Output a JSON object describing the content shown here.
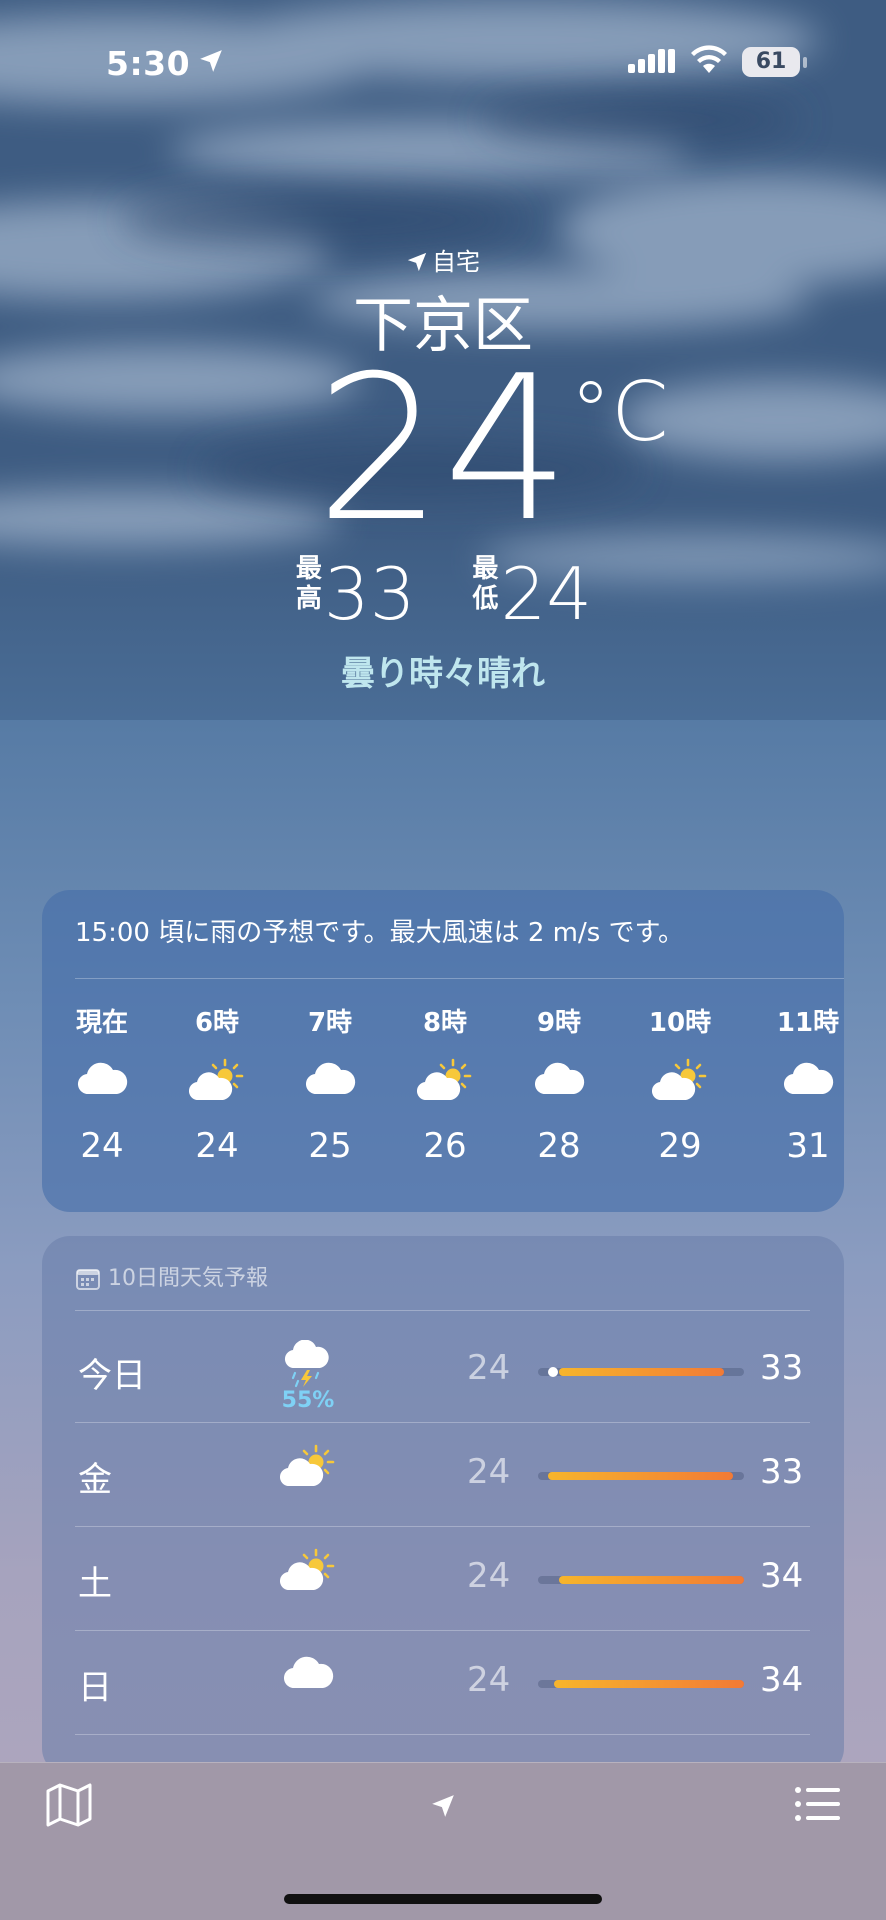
{
  "status_bar": {
    "time": "5:30",
    "battery": "61"
  },
  "location": {
    "label": "自宅",
    "city": "下京区",
    "temperature": "24",
    "unit": "°C",
    "high_label": "最高",
    "high": "33",
    "low_label": "最低",
    "low": "24",
    "condition": "曇り時々晴れ"
  },
  "hourly": {
    "summary": "15:00 頃に雨の予想です。最大風速は 2 m/s です。",
    "items": [
      {
        "time": "現在",
        "icon": "cloud-icon",
        "temp": "24"
      },
      {
        "time": "6時",
        "icon": "partly-sunny-icon",
        "temp": "24"
      },
      {
        "time": "7時",
        "icon": "cloud-icon",
        "temp": "25"
      },
      {
        "time": "8時",
        "icon": "partly-sunny-icon",
        "temp": "26"
      },
      {
        "time": "9時",
        "icon": "cloud-icon",
        "temp": "28"
      },
      {
        "time": "10時",
        "icon": "partly-sunny-icon",
        "temp": "29"
      },
      {
        "time": "11時",
        "icon": "cloud-icon",
        "temp": "31"
      }
    ]
  },
  "daily": {
    "title": "10日間天気予報",
    "range_colors": [
      "#f7b52c",
      "#f27a35"
    ],
    "days": [
      {
        "day": "今日",
        "icon": "thunderstorm-icon",
        "precip": "55%",
        "low": "24",
        "high": "33",
        "range_start": 0.1,
        "range_end": 0.9,
        "current": 0.05
      },
      {
        "day": "金",
        "icon": "partly-sunny-icon",
        "low": "24",
        "high": "33",
        "range_start": 0.05,
        "range_end": 0.95
      },
      {
        "day": "土",
        "icon": "partly-sunny-icon",
        "low": "24",
        "high": "34",
        "range_start": 0.1,
        "range_end": 1.0
      },
      {
        "day": "日",
        "icon": "cloud-icon",
        "low": "24",
        "high": "34",
        "range_start": 0.08,
        "range_end": 1.0
      }
    ]
  },
  "toolbar": {
    "map_icon": "map-icon",
    "location_icon": "location-arrow-icon",
    "list_icon": "list-icon"
  }
}
